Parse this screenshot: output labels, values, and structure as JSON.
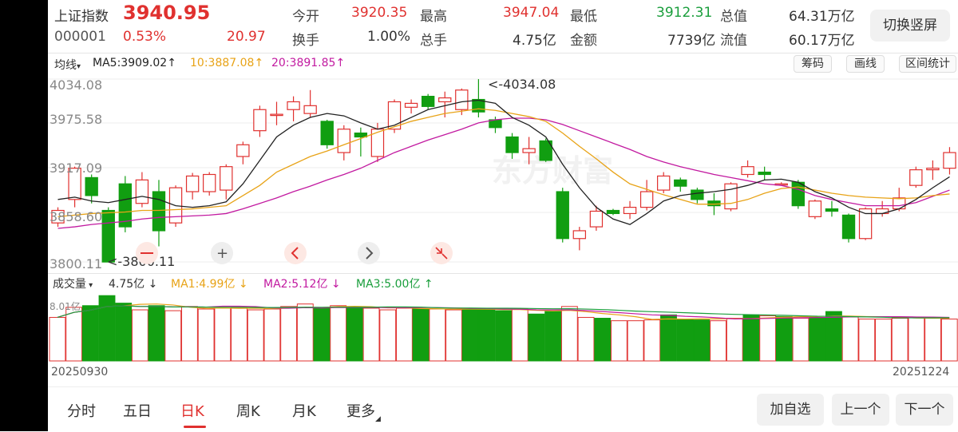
{
  "header": {
    "name": "上证指数",
    "code": "000001",
    "price": "3940.95",
    "change_pct": "0.53%",
    "change_amt": "20.97",
    "open_label": "今开",
    "open": "3920.35",
    "high_label": "最高",
    "high": "3947.04",
    "low_label": "最低",
    "low": "3912.31",
    "mcap_label": "总值",
    "mcap": "64.31万亿",
    "turnover_label": "换手",
    "turnover": "1.00%",
    "vol_label": "总手",
    "vol": "4.75亿",
    "amount_label": "金额",
    "amount": "7739亿",
    "float_label": "流值",
    "float": "60.17万亿",
    "switch_button": "切换竖屏"
  },
  "ma_bar": {
    "selector": "均线",
    "ma5": "MA5:3909.02",
    "ma10": "10:3887.08",
    "ma20": "20:3891.85",
    "btn_chips": "筹码",
    "btn_draw": "画线",
    "btn_range": "区间统计"
  },
  "price_axis": [
    "4034.08",
    "3975.58",
    "3917.09",
    "3858.60",
    "3800.11"
  ],
  "annotations": {
    "high": "<-4034.08",
    "low": "<-3800.11"
  },
  "watermark": "东方财富",
  "volume_bar": {
    "selector": "成交量",
    "vol": "4.75亿",
    "ma1": "MA1:4.99亿",
    "ma2": "MA2:5.12亿",
    "ma3": "MA3:5.00亿",
    "axis_top": "8.01亿"
  },
  "dates": {
    "start": "20250930",
    "end": "20251224"
  },
  "tabs": [
    "分时",
    "五日",
    "日K",
    "周K",
    "月K",
    "更多"
  ],
  "active_tab": 2,
  "buttons": {
    "add_watch": "加自选",
    "prev": "上一个",
    "next": "下一个"
  },
  "colors": {
    "up": "#e0312f",
    "down": "#119e11",
    "ma5": "#222222",
    "ma10": "#e8a317",
    "ma20": "#c21aa0",
    "vol_ma1": "#e8a317",
    "vol_ma2": "#c21aa0",
    "vol_ma3": "#1a9e3c"
  },
  "chart_data": {
    "type": "candlestick",
    "ylim": [
      3800.11,
      4034.08
    ],
    "candles": [
      {
        "o": 3850,
        "c": 3866,
        "h": 3870,
        "l": 3845
      },
      {
        "o": 3880,
        "c": 3920,
        "h": 3922,
        "l": 3870
      },
      {
        "o": 3908,
        "c": 3885,
        "h": 3912,
        "l": 3875
      },
      {
        "o": 3866,
        "c": 3800,
        "h": 3870,
        "l": 3800
      },
      {
        "o": 3900,
        "c": 3845,
        "h": 3910,
        "l": 3838
      },
      {
        "o": 3875,
        "c": 3905,
        "h": 3915,
        "l": 3870
      },
      {
        "o": 3890,
        "c": 3840,
        "h": 3905,
        "l": 3820
      },
      {
        "o": 3850,
        "c": 3895,
        "h": 3898,
        "l": 3845
      },
      {
        "o": 3890,
        "c": 3910,
        "h": 3914,
        "l": 3880
      },
      {
        "o": 3890,
        "c": 3912,
        "h": 3915,
        "l": 3885
      },
      {
        "o": 3892,
        "c": 3922,
        "h": 3925,
        "l": 3880
      },
      {
        "o": 3935,
        "c": 3950,
        "h": 3954,
        "l": 3925
      },
      {
        "o": 3968,
        "c": 3995,
        "h": 4000,
        "l": 3960
      },
      {
        "o": 3988,
        "c": 3989,
        "h": 4005,
        "l": 3975
      },
      {
        "o": 3995,
        "c": 4005,
        "h": 4012,
        "l": 3980
      },
      {
        "o": 3990,
        "c": 4000,
        "h": 4020,
        "l": 3985
      },
      {
        "o": 3980,
        "c": 3950,
        "h": 3982,
        "l": 3945
      },
      {
        "o": 3940,
        "c": 3970,
        "h": 3975,
        "l": 3930
      },
      {
        "o": 3965,
        "c": 3960,
        "h": 3972,
        "l": 3935
      },
      {
        "o": 3935,
        "c": 3970,
        "h": 3978,
        "l": 3928
      },
      {
        "o": 3970,
        "c": 4005,
        "h": 4008,
        "l": 3965
      },
      {
        "o": 3998,
        "c": 4003,
        "h": 4008,
        "l": 3990
      },
      {
        "o": 4012,
        "c": 3999,
        "h": 4015,
        "l": 3995
      },
      {
        "o": 4005,
        "c": 4010,
        "h": 4018,
        "l": 3985
      },
      {
        "o": 3995,
        "c": 4020,
        "h": 4022,
        "l": 3988
      },
      {
        "o": 4008,
        "c": 3992,
        "h": 4034,
        "l": 3985
      },
      {
        "o": 3982,
        "c": 3972,
        "h": 3986,
        "l": 3965
      },
      {
        "o": 3960,
        "c": 3940,
        "h": 3965,
        "l": 3932
      },
      {
        "o": 3940,
        "c": 3945,
        "h": 3960,
        "l": 3925
      },
      {
        "o": 3955,
        "c": 3930,
        "h": 3958,
        "l": 3928
      },
      {
        "o": 3890,
        "c": 3830,
        "h": 3895,
        "l": 3825
      },
      {
        "o": 3830,
        "c": 3840,
        "h": 3845,
        "l": 3815
      },
      {
        "o": 3845,
        "c": 3865,
        "h": 3872,
        "l": 3840
      },
      {
        "o": 3866,
        "c": 3862,
        "h": 3868,
        "l": 3860
      },
      {
        "o": 3862,
        "c": 3870,
        "h": 3878,
        "l": 3855
      },
      {
        "o": 3870,
        "c": 3890,
        "h": 3905,
        "l": 3866
      },
      {
        "o": 3892,
        "c": 3910,
        "h": 3915,
        "l": 3888
      },
      {
        "o": 3905,
        "c": 3897,
        "h": 3908,
        "l": 3890
      },
      {
        "o": 3892,
        "c": 3880,
        "h": 3895,
        "l": 3875
      },
      {
        "o": 3878,
        "c": 3872,
        "h": 3888,
        "l": 3860
      },
      {
        "o": 3868,
        "c": 3900,
        "h": 3902,
        "l": 3865
      },
      {
        "o": 3912,
        "c": 3922,
        "h": 3930,
        "l": 3908
      },
      {
        "o": 3915,
        "c": 3912,
        "h": 3922,
        "l": 3905
      },
      {
        "o": 3900,
        "c": 3900,
        "h": 3902,
        "l": 3898
      },
      {
        "o": 3902,
        "c": 3872,
        "h": 3905,
        "l": 3868
      },
      {
        "o": 3858,
        "c": 3878,
        "h": 3880,
        "l": 3855
      },
      {
        "o": 3868,
        "c": 3865,
        "h": 3878,
        "l": 3858
      },
      {
        "o": 3860,
        "c": 3830,
        "h": 3862,
        "l": 3825
      },
      {
        "o": 3830,
        "c": 3868,
        "h": 3870,
        "l": 3828
      },
      {
        "o": 3862,
        "c": 3868,
        "h": 3878,
        "l": 3858
      },
      {
        "o": 3868,
        "c": 3882,
        "h": 3895,
        "l": 3865
      },
      {
        "o": 3898,
        "c": 3918,
        "h": 3922,
        "l": 3895
      },
      {
        "o": 3918,
        "c": 3920,
        "h": 3930,
        "l": 3905
      },
      {
        "o": 3920,
        "c": 3940,
        "h": 3947,
        "l": 3912
      }
    ],
    "ma5": [
      3880,
      3883,
      3878,
      3876,
      3880,
      3884,
      3880,
      3872,
      3870,
      3872,
      3877,
      3900,
      3930,
      3960,
      3975,
      3985,
      3990,
      3987,
      3978,
      3970,
      3975,
      3985,
      3995,
      4000,
      4005,
      4007,
      4003,
      3985,
      3975,
      3960,
      3925,
      3895,
      3870,
      3855,
      3848,
      3862,
      3878,
      3885,
      3888,
      3890,
      3893,
      3898,
      3905,
      3906,
      3902,
      3890,
      3882,
      3870,
      3862,
      3862,
      3868,
      3880,
      3895,
      3909
    ],
    "ma10": [
      3858,
      3860,
      3862,
      3863,
      3864,
      3866,
      3866,
      3867,
      3868,
      3870,
      3872,
      3885,
      3898,
      3915,
      3925,
      3935,
      3942,
      3950,
      3958,
      3966,
      3973,
      3980,
      3985,
      3990,
      3993,
      3996,
      3994,
      3990,
      3986,
      3980,
      3965,
      3948,
      3932,
      3915,
      3900,
      3893,
      3886,
      3880,
      3874,
      3874,
      3875,
      3880,
      3888,
      3894,
      3896,
      3892,
      3888,
      3885,
      3883,
      3882,
      3881,
      3882,
      3885,
      3887
    ],
    "ma20": [
      3843,
      3845,
      3848,
      3850,
      3852,
      3855,
      3857,
      3858,
      3859,
      3860,
      3862,
      3868,
      3875,
      3882,
      3890,
      3897,
      3905,
      3912,
      3920,
      3930,
      3940,
      3948,
      3956,
      3963,
      3970,
      3978,
      3982,
      3984,
      3984,
      3982,
      3976,
      3968,
      3960,
      3952,
      3944,
      3935,
      3928,
      3922,
      3917,
      3912,
      3908,
      3904,
      3900,
      3898,
      3893,
      3885,
      3880,
      3876,
      3872,
      3872,
      3872,
      3876,
      3884,
      3892
    ],
    "volume": [
      5.2,
      6.4,
      6.6,
      7.8,
      6.9,
      6.1,
      6.6,
      6.0,
      6.5,
      6.2,
      6.3,
      6.4,
      6.1,
      6.2,
      6.5,
      6.8,
      6.3,
      6.6,
      6.4,
      6.3,
      6.1,
      6.3,
      6.2,
      6.2,
      6.1,
      6.2,
      6.2,
      6.0,
      6.2,
      5.6,
      5.9,
      6.5,
      5.2,
      5.1,
      4.8,
      4.8,
      4.9,
      5.5,
      5.0,
      4.9,
      4.8,
      5.1,
      5.5,
      5.4,
      5.3,
      5.1,
      5.2,
      5.9,
      5.3,
      5.0,
      5.0,
      5.1,
      5.2,
      5.2,
      5.0
    ],
    "vol_ylim": [
      0,
      8.01
    ],
    "x_start": "20250930",
    "x_end": "20251224"
  }
}
